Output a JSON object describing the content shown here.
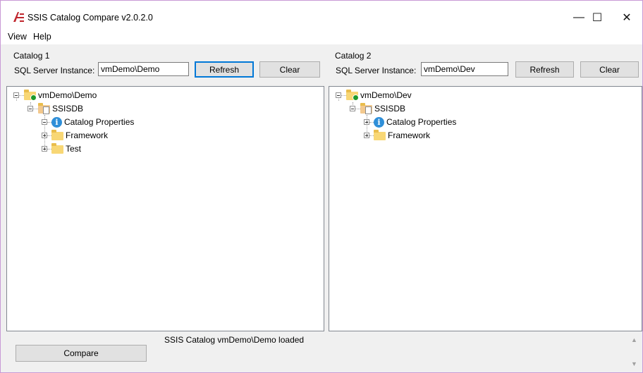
{
  "window": {
    "title": "SSIS Catalog Compare v2.0.2.0",
    "controls": {
      "minimize": "—",
      "maximize": "☐",
      "close": "✕"
    }
  },
  "menu": {
    "items": [
      "View",
      "Help"
    ]
  },
  "catalog1": {
    "group_label": "Catalog 1",
    "instance_label": "SQL Server Instance:",
    "instance_value": "vmDemo\\Demo",
    "refresh_label": "Refresh",
    "clear_label": "Clear",
    "tree": {
      "server": "vmDemo\\Demo",
      "database": "SSISDB",
      "children": [
        "Catalog Properties",
        "Framework",
        "Test"
      ]
    }
  },
  "catalog2": {
    "group_label": "Catalog 2",
    "instance_label": "SQL Server Instance:",
    "instance_value": "vmDemo\\Dev",
    "refresh_label": "Refresh",
    "clear_label": "Clear",
    "tree": {
      "server": "vmDemo\\Dev",
      "database": "SSISDB",
      "children": [
        "Catalog Properties",
        "Framework"
      ]
    }
  },
  "compare_label": "Compare",
  "status": "SSIS Catalog vmDemo\\Demo loaded",
  "icons": {
    "app": "ssis-compare-icon",
    "server": "server-folder-icon",
    "database": "database-icon",
    "info": "info-icon",
    "folder": "folder-icon"
  },
  "colors": {
    "accent": "#0078d7",
    "info": "#2f8fd8",
    "folder": "#f8d775",
    "server_dot": "#1e9a2a"
  }
}
